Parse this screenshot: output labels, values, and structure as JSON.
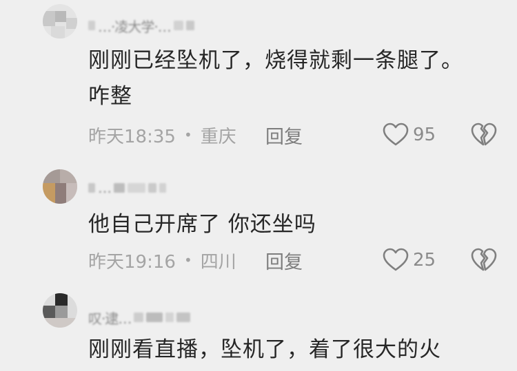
{
  "comments": [
    {
      "username": "…·凌大学·…",
      "content_lines": [
        "刚刚已经坠机了，烧得就剩一条腿了。",
        "咋整"
      ],
      "time": "昨天18:35",
      "location": "重庆",
      "reply_label": "回复",
      "likes": "95"
    },
    {
      "username": "…",
      "content_lines": [
        "他自己开席了 你还坐吗"
      ],
      "time": "昨天19:16",
      "location": "四川",
      "reply_label": "回复",
      "likes": "25"
    },
    {
      "username": "叹‧逮…",
      "content_lines": [
        "刚刚看直播，坠机了，着了很大的火"
      ]
    }
  ],
  "colors": {
    "background": "#efefef",
    "text": "#262626",
    "meta": "#a4a4a4",
    "icon": "#7f7f7f"
  },
  "icons": {
    "like": "heart-outline-icon",
    "dislike": "broken-heart-icon"
  }
}
